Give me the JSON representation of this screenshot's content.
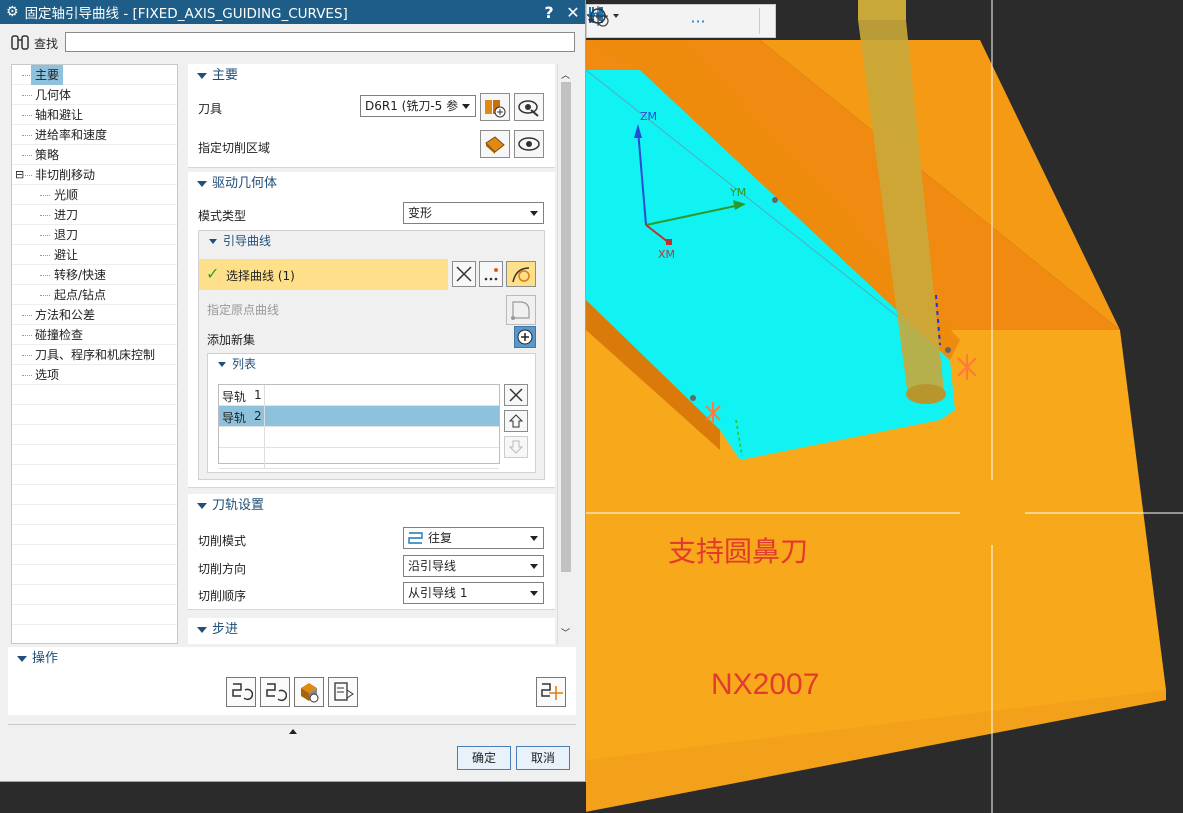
{
  "dialog": {
    "title": "固定轴引导曲线 - [FIXED_AXIS_GUIDING_CURVES]",
    "help": "?",
    "close": "✕",
    "find_label": "查找",
    "find_value": ""
  },
  "tree": [
    {
      "label": "主要",
      "level": 0,
      "selected": true
    },
    {
      "label": "几何体",
      "level": 0
    },
    {
      "label": "轴和避让",
      "level": 0
    },
    {
      "label": "进给率和速度",
      "level": 0
    },
    {
      "label": "策略",
      "level": 0
    },
    {
      "label": "非切削移动",
      "level": 0,
      "expander": "⊟"
    },
    {
      "label": "光顺",
      "level": 1
    },
    {
      "label": "进刀",
      "level": 1
    },
    {
      "label": "退刀",
      "level": 1
    },
    {
      "label": "避让",
      "level": 1
    },
    {
      "label": "转移/快速",
      "level": 1
    },
    {
      "label": "起点/钻点",
      "level": 1
    },
    {
      "label": "方法和公差",
      "level": 0
    },
    {
      "label": "碰撞检查",
      "level": 0
    },
    {
      "label": "刀具、程序和机床控制",
      "level": 0
    },
    {
      "label": "选项",
      "level": 0
    }
  ],
  "main": {
    "heading": "主要",
    "tool_label": "刀具",
    "tool_value": "D6R1 (铣刀-5 参",
    "cut_area_label": "指定切削区域"
  },
  "drive": {
    "heading": "驱动几何体",
    "mode_label": "模式类型",
    "mode_value": "变形",
    "guide_heading": "引导曲线",
    "select_curve": "选择曲线 (1)",
    "origin_curve": "指定原点曲线",
    "add_set": "添加新集",
    "list_heading": "列表",
    "list_rows": [
      {
        "name": "导轨",
        "num": "1",
        "selected": false
      },
      {
        "name": "导轨",
        "num": "2",
        "selected": true
      }
    ]
  },
  "path": {
    "heading": "刀轨设置",
    "cut_mode_label": "切削模式",
    "cut_mode_value": "往复",
    "cut_dir_label": "切削方向",
    "cut_dir_value": "沿引导线",
    "cut_order_label": "切削顺序",
    "cut_order_value": "从引导线 1"
  },
  "step": {
    "heading": "步进"
  },
  "ops": {
    "heading": "操作"
  },
  "buttons": {
    "ok": "确定",
    "cancel": "取消"
  },
  "viewport": {
    "text1": "支持圆鼻刀",
    "text2": "NX2007",
    "axis_zm": "ZM",
    "axis_ym": "YM",
    "axis_xm": "XM",
    "toolbar_dots": "···"
  },
  "colors": {
    "title_bar": "#1e5d87",
    "part_orange": "#f7a81b",
    "floor_cyan": "#00ffff",
    "selection_yellow": "#ffe08a",
    "annotation_red": "#e23b2e"
  }
}
